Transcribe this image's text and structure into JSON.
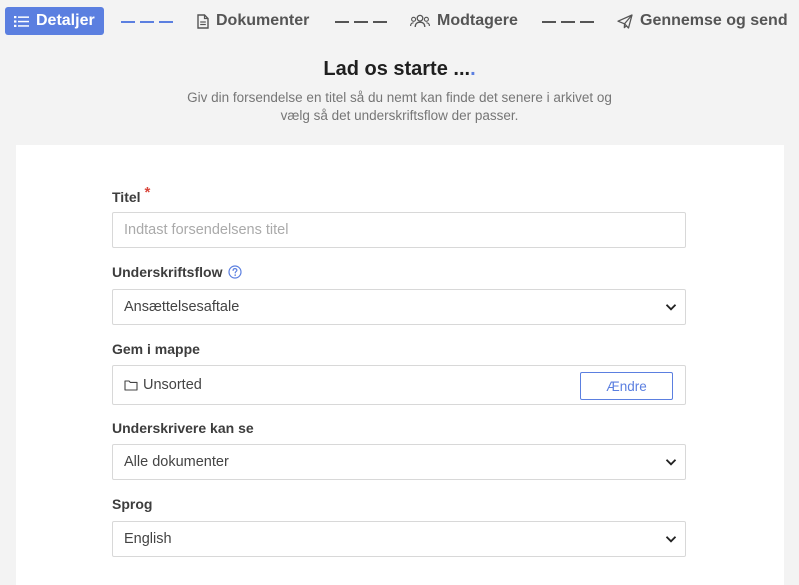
{
  "stepper": {
    "steps": [
      {
        "label": "Detaljer",
        "icon": "list-icon",
        "active": true
      },
      {
        "label": "Dokumenter",
        "icon": "document-icon",
        "active": false
      },
      {
        "label": "Modtagere",
        "icon": "users-icon",
        "active": false
      },
      {
        "label": "Gennemse og send",
        "icon": "send-icon",
        "active": false
      }
    ]
  },
  "header": {
    "title": "Lad os starte ...",
    "title_dot": ".",
    "subtitle_line1": "Giv din forsendelse en titel så du nemt kan finde det senere i arkivet og",
    "subtitle_line2": "vælg så det underskriftsflow der passer."
  },
  "form": {
    "title_label": "Titel",
    "required_mark": "*",
    "title_placeholder": "Indtast forsendelsens titel",
    "flow_label": "Underskriftsflow",
    "flow_value": "Ansættelsesaftale",
    "folder_label": "Gem i mappe",
    "folder_value": "Unsorted",
    "change_button": "Ændre",
    "signers_label": "Underskrivere kan se",
    "signers_value": "Alle dokumenter",
    "language_label": "Sprog",
    "language_value": "English"
  },
  "colors": {
    "accent": "#5b7fe0",
    "required": "#d9463b",
    "background": "#f3f3f3"
  }
}
